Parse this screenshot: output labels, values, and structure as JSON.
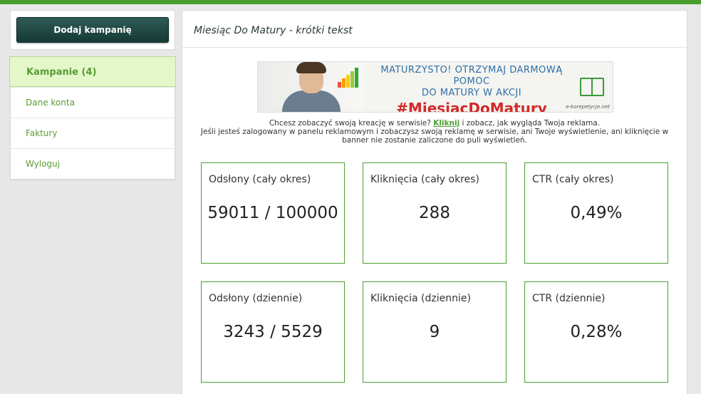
{
  "sidebar": {
    "add_button": "Dodaj kampanię",
    "items": [
      {
        "label": "Kampanie (4)",
        "active": true
      },
      {
        "label": "Dane konta"
      },
      {
        "label": "Faktury"
      },
      {
        "label": "Wyloguj"
      }
    ]
  },
  "main": {
    "title": "Miesiąc Do Matury - krótki tekst",
    "banner": {
      "line1": "MATURZYSTO! OTRZYMAJ DARMOWĄ POMOC",
      "line2": "DO MATURY W AKCJI",
      "line3": "#MiesiącDoMatury",
      "brand": "e-korepetycje.net"
    },
    "info": {
      "prefix": "Chcesz zobaczyć swoją kreację w serwisie? ",
      "link": "Kliknij",
      "suffix": " i zobacz, jak wygląda Twoja reklama.",
      "line2": "Jeśli jesteś zalogowany w panelu reklamowym i zobaczysz swoją reklamę w serwisie, ani Twoje wyświetlenie, ani kliknięcie w",
      "line3": "banner nie zostanie zaliczone do puli wyświetleń."
    },
    "stats": [
      {
        "label": "Odsłony (cały okres)",
        "value": "59011 / 100000"
      },
      {
        "label": "Kliknięcia (cały okres)",
        "value": "288"
      },
      {
        "label": "CTR (cały okres)",
        "value": "0,49%"
      },
      {
        "label": "Odsłony (dziennie)",
        "value": "3243 / 5529"
      },
      {
        "label": "Kliknięcia (dziennie)",
        "value": "9"
      },
      {
        "label": "CTR (dziennie)",
        "value": "0,28%"
      }
    ]
  },
  "colors": {
    "accent_green": "#4a9e2f",
    "button_dark": "#1f4642",
    "active_bg": "#e3f7c9"
  }
}
